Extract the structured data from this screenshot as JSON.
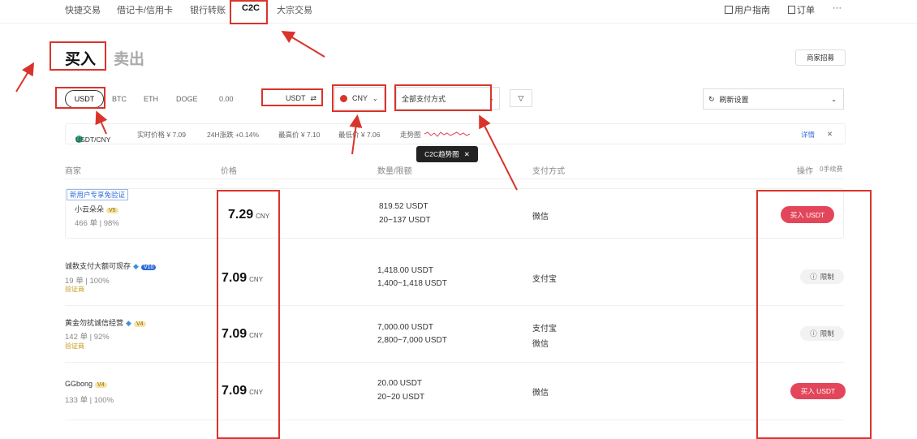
{
  "topnav": {
    "tabs": [
      "快捷交易",
      "借记卡/信用卡",
      "银行转账",
      "C2C",
      "大宗交易"
    ],
    "user_guide": "用户指南",
    "orders": "订单",
    "more": "···"
  },
  "trade": {
    "buy_label": "买入",
    "sell_label": "卖出",
    "merchant_apply": "商家招募"
  },
  "coins": [
    "USDT",
    "BTC",
    "ETH",
    "DOGE",
    "0.00"
  ],
  "filters": {
    "asset": "USDT",
    "fiat": "CNY",
    "payment": "全部支付方式",
    "refresh": "刷新设置"
  },
  "info_strip": {
    "pair": "USDT/CNY",
    "realtime": "实时价格 ¥ 7.09",
    "change": "24H涨跌 +0.14%",
    "high": "最高价 ¥ 7.10",
    "low": "最低价 ¥ 7.06",
    "trend": "走势图",
    "details": "详情",
    "tooltip": "C2C趋势图"
  },
  "table": {
    "headers": [
      "商家",
      "价格",
      "数量/限额",
      "支付方式",
      "操作",
      "0手续费"
    ],
    "rows": [
      {
        "tag": "新用户专享免验证",
        "name": "小云朵朵",
        "level": "V5",
        "stats": "466 单 | 98%",
        "price": "7.29",
        "unit": "CNY",
        "amount": "819.52 USDT",
        "limit": "20~137 USDT",
        "pay": [
          "微信"
        ],
        "action": "买入 USDT"
      },
      {
        "name": "诚数支付大额可现存",
        "level": "V10",
        "stats": "19 单 | 100%",
        "verified": "验证商",
        "price": "7.09",
        "unit": "CNY",
        "amount": "1,418.00 USDT",
        "limit": "1,400~1,418 USDT",
        "pay": [
          "支付宝"
        ],
        "action": "限制"
      },
      {
        "name": "黄金勿扰诚信经营",
        "level": "V4",
        "stats": "142 单 | 92%",
        "verified": "验证商",
        "price": "7.09",
        "unit": "CNY",
        "amount": "7,000.00 USDT",
        "limit": "2,800~7,000 USDT",
        "pay": [
          "支付宝",
          "微信"
        ],
        "action": "限制"
      },
      {
        "name": "GGbong",
        "level": "V4",
        "stats": "133 单 | 100%",
        "price": "7.09",
        "unit": "CNY",
        "amount": "20.00 USDT",
        "limit": "20~20 USDT",
        "pay": [
          "微信"
        ],
        "action": "买入 USDT"
      }
    ]
  },
  "colors": {
    "accent": "#e3465a",
    "annotation": "#d9342b"
  }
}
